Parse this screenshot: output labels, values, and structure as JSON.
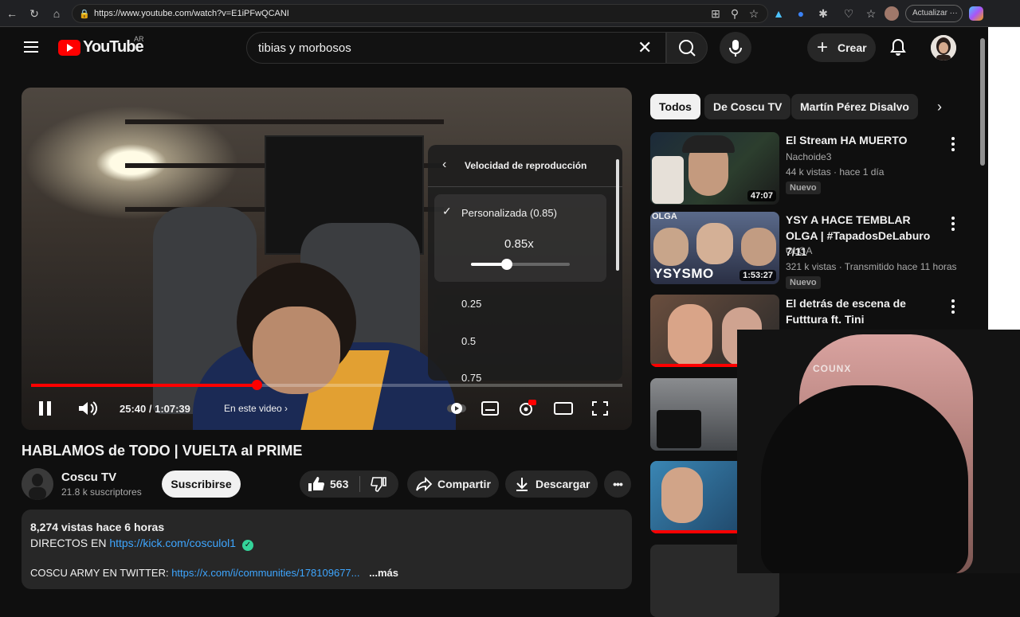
{
  "browser": {
    "url": "https://www.youtube.com/watch?v=E1iPFwQCANI",
    "update_label": "Actualizar"
  },
  "header": {
    "logo_text": "YouTube",
    "country": "AR",
    "search_value": "tibias y morbosos",
    "create_label": "Crear"
  },
  "player": {
    "speed_menu": {
      "title": "Velocidad de reproducción",
      "custom_label": "Personalizada (0.85)",
      "current_value": "0.85x",
      "slider_fraction": 0.36,
      "options": [
        "0.25",
        "0.5",
        "0.75"
      ]
    },
    "progress_fraction": 0.381,
    "time": "25:40 / 1:07:39",
    "chapter_label": "En este video"
  },
  "video": {
    "title": "HABLAMOS de TODO | VUELTA al PRIME",
    "channel": "Coscu TV",
    "subscribers": "21.8 k suscriptores",
    "subscribe_label": "Suscribirse",
    "likes": "563",
    "share_label": "Compartir",
    "download_label": "Descargar"
  },
  "description": {
    "meta": "8,274 vistas  hace 6 horas",
    "line1_prefix": "DIRECTOS EN ",
    "line1_link": "https://kick.com/cosculol1",
    "line2_prefix": "COSCU ARMY EN TWITTER: ",
    "line2_link": "https://x.com/i/communities/178109677...",
    "more": "...más"
  },
  "chips": [
    "Todos",
    "De Coscu TV",
    "Martín Pérez Disalvo"
  ],
  "recommendations": [
    {
      "title": "El Stream HA MUERTO",
      "channel": "Nachoide3",
      "meta": "44 k vistas · hace 1 día",
      "badge": "Nuevo",
      "duration": "47:07"
    },
    {
      "title": "YSY A HACE TEMBLAR OLGA | #TapadosDeLaburo 7/11",
      "channel": "OLGA",
      "meta": "321 k vistas · Transmitido hace 11 horas",
      "badge": "Nuevo",
      "duration": "1:53:27",
      "thumb_caption": "YSYSMO",
      "thumb_tag": "OLGA"
    },
    {
      "title": "El detrás de escena de Futttura ft. Tini"
    }
  ],
  "webcam": {
    "chair_brand": "COUNX"
  },
  "colors": {
    "brand_red": "#ff0000",
    "link_blue": "#3ea6ff"
  }
}
